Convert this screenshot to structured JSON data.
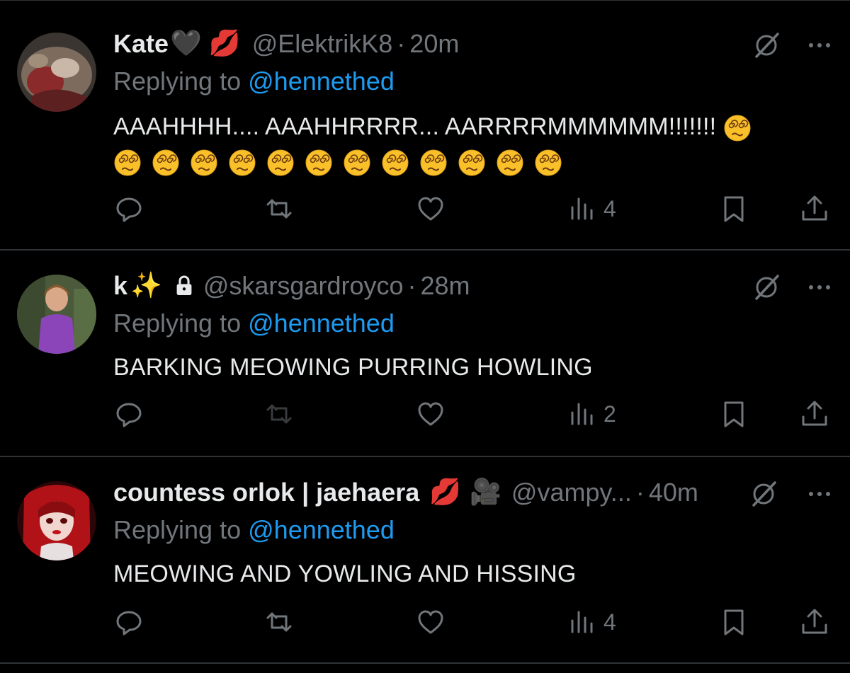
{
  "tweets": [
    {
      "display_name": "Kate",
      "name_emojis": [
        "🖤",
        "💋"
      ],
      "handle": "@ElektrikK8",
      "separator": "·",
      "time": "20m",
      "replying_prefix": "Replying to",
      "replying_to": "@hennethed",
      "text": "AAAHHHH.... AAAHHRRRR... AARRRRMMMMMM!!!!!!!",
      "trailing_emoji_count": 13,
      "trailing_emoji_name": "face-with-spiral-eyes",
      "views": "4",
      "avatar_icon": "avatar-kate"
    },
    {
      "display_name": "k",
      "name_emojis": [
        "✨"
      ],
      "protected": true,
      "handle": "@skarsgardroyco",
      "separator": "·",
      "time": "28m",
      "replying_prefix": "Replying to",
      "replying_to": "@hennethed",
      "text": "BARKING MEOWING PURRING HOWLING",
      "views": "2",
      "avatar_icon": "avatar-k"
    },
    {
      "display_name": "countess orlok | jaehaera",
      "name_emojis": [
        "💋",
        "🎥"
      ],
      "handle": "@vampy...",
      "separator": "·",
      "time": "40m",
      "replying_prefix": "Replying to",
      "replying_to": "@hennethed",
      "text": "MEOWING AND YOWLING AND HISSING",
      "views": "4",
      "avatar_icon": "avatar-countess"
    }
  ],
  "colors": {
    "background": "#000000",
    "primary_text": "#e7e9ea",
    "secondary_text": "#71767b",
    "link": "#1d9bf0",
    "divider": "#2f3336"
  },
  "icons": [
    "reply-icon",
    "retweet-icon",
    "like-icon",
    "views-icon",
    "bookmark-icon",
    "share-icon",
    "grok-icon",
    "more-icon",
    "lock-icon"
  ]
}
